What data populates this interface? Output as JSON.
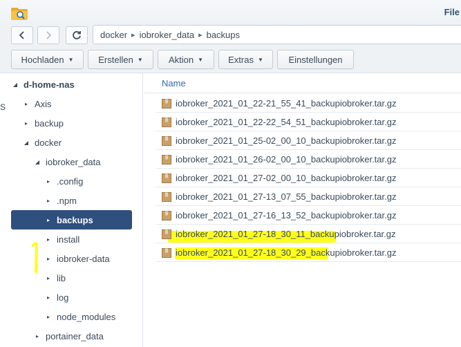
{
  "window": {
    "title": "File"
  },
  "nav": {
    "back_icon": "chevron-left-icon",
    "forward_icon": "chevron-right-icon",
    "refresh_icon": "refresh-icon",
    "breadcrumb": [
      "docker",
      "iobroker_data",
      "backups"
    ]
  },
  "toolbar": {
    "upload_label": "Hochladen",
    "create_label": "Erstellen",
    "action_label": "Aktion",
    "extras_label": "Extras",
    "settings_label": "Einstellungen"
  },
  "sidebar": {
    "stray_text": "S",
    "items": [
      {
        "label": "d-home-nas",
        "expanded": true
      },
      {
        "label": "Axis",
        "expanded": false
      },
      {
        "label": "backup",
        "expanded": false
      },
      {
        "label": "docker",
        "expanded": true
      },
      {
        "label": "iobroker_data",
        "expanded": true
      },
      {
        "label": ".config",
        "expanded": false
      },
      {
        "label": ".npm",
        "expanded": false
      },
      {
        "label": "backups",
        "expanded": false,
        "selected": true
      },
      {
        "label": "install",
        "expanded": false
      },
      {
        "label": "iobroker-data",
        "expanded": false
      },
      {
        "label": "lib",
        "expanded": false
      },
      {
        "label": "log",
        "expanded": false
      },
      {
        "label": "node_modules",
        "expanded": false
      },
      {
        "label": "portainer_data",
        "expanded": false
      }
    ]
  },
  "list": {
    "column_name": "Name",
    "files": [
      "iobroker_2021_01_22-21_55_41_backupiobroker.tar.gz",
      "iobroker_2021_01_22-22_54_51_backupiobroker.tar.gz",
      "iobroker_2021_01_25-02_00_10_backupiobroker.tar.gz",
      "iobroker_2021_01_26-02_00_10_backupiobroker.tar.gz",
      "iobroker_2021_01_27-02_00_10_backupiobroker.tar.gz",
      "iobroker_2021_01_27-13_07_55_backupiobroker.tar.gz",
      "iobroker_2021_01_27-16_13_52_backupiobroker.tar.gz",
      "iobroker_2021_01_27-18_30_11_backupiobroker.tar.gz",
      "iobroker_2021_01_27-18_30_29_backupiobroker.tar.gz"
    ]
  },
  "colors": {
    "selected_bg": "#2f4f7e",
    "highlight": "#ffff1a",
    "link": "#2b6bb3"
  }
}
